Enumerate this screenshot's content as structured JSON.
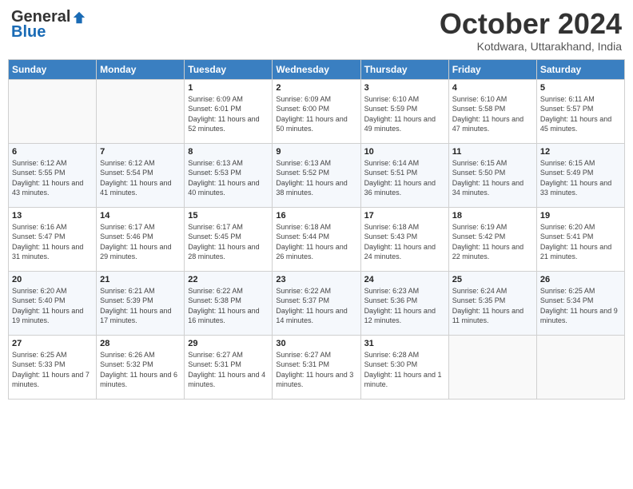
{
  "header": {
    "logo_general": "General",
    "logo_blue": "Blue",
    "month_title": "October 2024",
    "location": "Kotdwara, Uttarakhand, India"
  },
  "days_of_week": [
    "Sunday",
    "Monday",
    "Tuesday",
    "Wednesday",
    "Thursday",
    "Friday",
    "Saturday"
  ],
  "weeks": [
    [
      {
        "day": "",
        "info": ""
      },
      {
        "day": "",
        "info": ""
      },
      {
        "day": "1",
        "info": "Sunrise: 6:09 AM\nSunset: 6:01 PM\nDaylight: 11 hours and 52 minutes."
      },
      {
        "day": "2",
        "info": "Sunrise: 6:09 AM\nSunset: 6:00 PM\nDaylight: 11 hours and 50 minutes."
      },
      {
        "day": "3",
        "info": "Sunrise: 6:10 AM\nSunset: 5:59 PM\nDaylight: 11 hours and 49 minutes."
      },
      {
        "day": "4",
        "info": "Sunrise: 6:10 AM\nSunset: 5:58 PM\nDaylight: 11 hours and 47 minutes."
      },
      {
        "day": "5",
        "info": "Sunrise: 6:11 AM\nSunset: 5:57 PM\nDaylight: 11 hours and 45 minutes."
      }
    ],
    [
      {
        "day": "6",
        "info": "Sunrise: 6:12 AM\nSunset: 5:55 PM\nDaylight: 11 hours and 43 minutes."
      },
      {
        "day": "7",
        "info": "Sunrise: 6:12 AM\nSunset: 5:54 PM\nDaylight: 11 hours and 41 minutes."
      },
      {
        "day": "8",
        "info": "Sunrise: 6:13 AM\nSunset: 5:53 PM\nDaylight: 11 hours and 40 minutes."
      },
      {
        "day": "9",
        "info": "Sunrise: 6:13 AM\nSunset: 5:52 PM\nDaylight: 11 hours and 38 minutes."
      },
      {
        "day": "10",
        "info": "Sunrise: 6:14 AM\nSunset: 5:51 PM\nDaylight: 11 hours and 36 minutes."
      },
      {
        "day": "11",
        "info": "Sunrise: 6:15 AM\nSunset: 5:50 PM\nDaylight: 11 hours and 34 minutes."
      },
      {
        "day": "12",
        "info": "Sunrise: 6:15 AM\nSunset: 5:49 PM\nDaylight: 11 hours and 33 minutes."
      }
    ],
    [
      {
        "day": "13",
        "info": "Sunrise: 6:16 AM\nSunset: 5:47 PM\nDaylight: 11 hours and 31 minutes."
      },
      {
        "day": "14",
        "info": "Sunrise: 6:17 AM\nSunset: 5:46 PM\nDaylight: 11 hours and 29 minutes."
      },
      {
        "day": "15",
        "info": "Sunrise: 6:17 AM\nSunset: 5:45 PM\nDaylight: 11 hours and 28 minutes."
      },
      {
        "day": "16",
        "info": "Sunrise: 6:18 AM\nSunset: 5:44 PM\nDaylight: 11 hours and 26 minutes."
      },
      {
        "day": "17",
        "info": "Sunrise: 6:18 AM\nSunset: 5:43 PM\nDaylight: 11 hours and 24 minutes."
      },
      {
        "day": "18",
        "info": "Sunrise: 6:19 AM\nSunset: 5:42 PM\nDaylight: 11 hours and 22 minutes."
      },
      {
        "day": "19",
        "info": "Sunrise: 6:20 AM\nSunset: 5:41 PM\nDaylight: 11 hours and 21 minutes."
      }
    ],
    [
      {
        "day": "20",
        "info": "Sunrise: 6:20 AM\nSunset: 5:40 PM\nDaylight: 11 hours and 19 minutes."
      },
      {
        "day": "21",
        "info": "Sunrise: 6:21 AM\nSunset: 5:39 PM\nDaylight: 11 hours and 17 minutes."
      },
      {
        "day": "22",
        "info": "Sunrise: 6:22 AM\nSunset: 5:38 PM\nDaylight: 11 hours and 16 minutes."
      },
      {
        "day": "23",
        "info": "Sunrise: 6:22 AM\nSunset: 5:37 PM\nDaylight: 11 hours and 14 minutes."
      },
      {
        "day": "24",
        "info": "Sunrise: 6:23 AM\nSunset: 5:36 PM\nDaylight: 11 hours and 12 minutes."
      },
      {
        "day": "25",
        "info": "Sunrise: 6:24 AM\nSunset: 5:35 PM\nDaylight: 11 hours and 11 minutes."
      },
      {
        "day": "26",
        "info": "Sunrise: 6:25 AM\nSunset: 5:34 PM\nDaylight: 11 hours and 9 minutes."
      }
    ],
    [
      {
        "day": "27",
        "info": "Sunrise: 6:25 AM\nSunset: 5:33 PM\nDaylight: 11 hours and 7 minutes."
      },
      {
        "day": "28",
        "info": "Sunrise: 6:26 AM\nSunset: 5:32 PM\nDaylight: 11 hours and 6 minutes."
      },
      {
        "day": "29",
        "info": "Sunrise: 6:27 AM\nSunset: 5:31 PM\nDaylight: 11 hours and 4 minutes."
      },
      {
        "day": "30",
        "info": "Sunrise: 6:27 AM\nSunset: 5:31 PM\nDaylight: 11 hours and 3 minutes."
      },
      {
        "day": "31",
        "info": "Sunrise: 6:28 AM\nSunset: 5:30 PM\nDaylight: 11 hours and 1 minute."
      },
      {
        "day": "",
        "info": ""
      },
      {
        "day": "",
        "info": ""
      }
    ]
  ]
}
